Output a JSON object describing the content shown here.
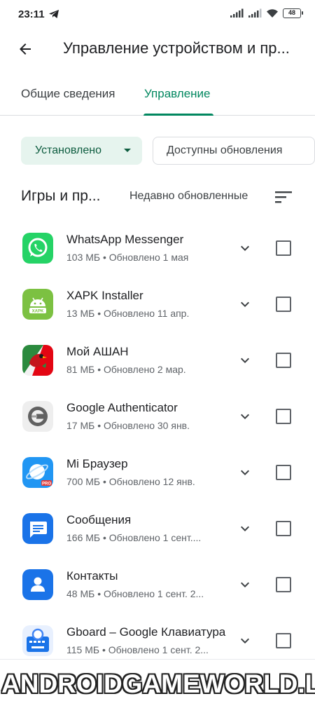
{
  "status_bar": {
    "time": "23:11",
    "battery": "48",
    "icons": [
      "telegram-icon",
      "signal-icon",
      "signal-icon",
      "wifi-icon",
      "battery-icon"
    ]
  },
  "header": {
    "title": "Управление устройством и пр..."
  },
  "tabs": [
    {
      "label": "Общие сведения",
      "active": false
    },
    {
      "label": "Управление",
      "active": true
    }
  ],
  "chips": {
    "installed": "Установлено",
    "updates": "Доступны обновления"
  },
  "section": {
    "title": "Игры и пр...",
    "sort_label": "Недавно обновленные"
  },
  "apps": [
    {
      "name": "WhatsApp Messenger",
      "meta": "103 МБ • Обновлено 1 мая",
      "icon": "whatsapp-icon"
    },
    {
      "name": "XAPK Installer",
      "meta": "13 МБ • Обновлено 11 апр.",
      "icon": "xapk-icon",
      "icon_text": "XAPK"
    },
    {
      "name": "Мой АШАН",
      "meta": "81 МБ • Обновлено 2 мар.",
      "icon": "auchan-icon"
    },
    {
      "name": "Google Authenticator",
      "meta": "17 МБ • Обновлено 30 янв.",
      "icon": "authenticator-icon"
    },
    {
      "name": "Mi Браузер",
      "meta": "700 МБ • Обновлено 12 янв.",
      "icon": "mi-browser-icon",
      "icon_text": "PRO"
    },
    {
      "name": "Сообщения",
      "meta": "166 МБ • Обновлено 1 сент....",
      "icon": "messages-icon"
    },
    {
      "name": "Контакты",
      "meta": "48 МБ • Обновлено 1 сент. 2...",
      "icon": "contacts-icon"
    },
    {
      "name": "Gboard – Google Клавиатура",
      "meta": "115 МБ • Обновлено 1 сент. 2...",
      "icon": "gboard-icon"
    }
  ],
  "colors": {
    "accent": "#01875f",
    "chip_bg": "#e6f4ee",
    "text_primary": "#202124",
    "text_secondary": "#5f6368"
  },
  "watermark": "ANDROIDGAMEWORLD.LA"
}
